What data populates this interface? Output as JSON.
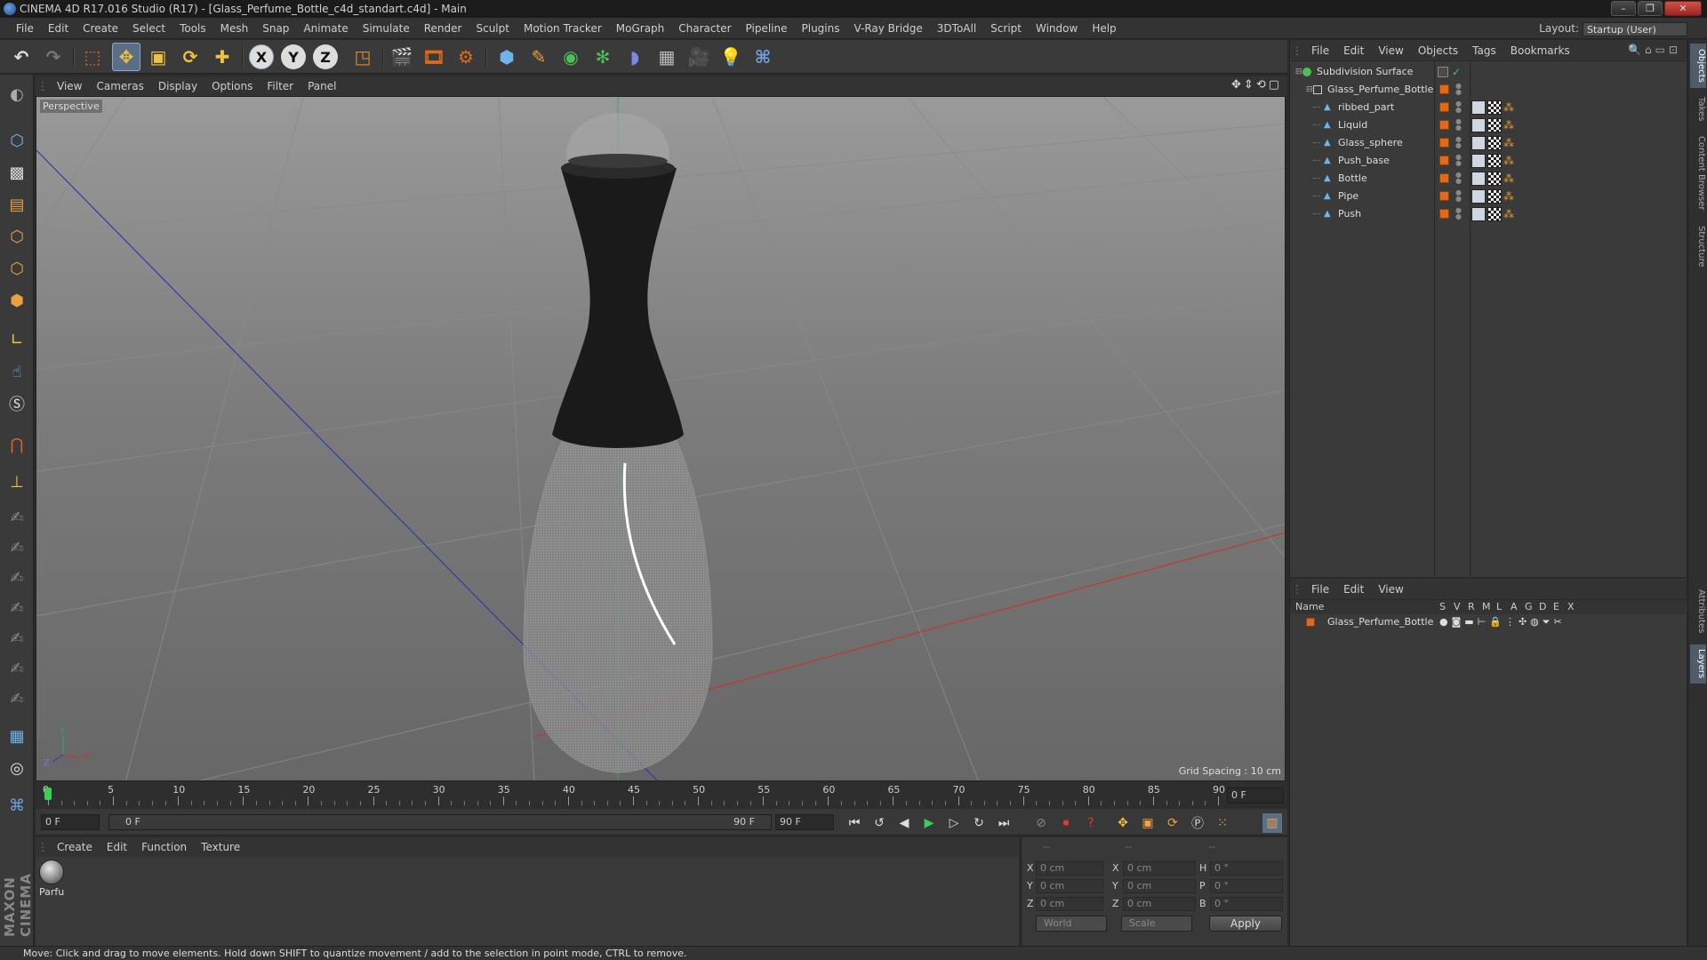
{
  "title": "CINEMA 4D R17.016 Studio (R17) - [Glass_Perfume_Bottle_c4d_standart.c4d] - Main",
  "menu": [
    "File",
    "Edit",
    "Create",
    "Select",
    "Tools",
    "Mesh",
    "Snap",
    "Animate",
    "Simulate",
    "Render",
    "Sculpt",
    "Motion Tracker",
    "MoGraph",
    "Character",
    "Pipeline",
    "Plugins",
    "V-Ray Bridge",
    "3DToAll",
    "Script",
    "Window",
    "Help"
  ],
  "layout": {
    "label": "Layout:",
    "value": "Startup (User)"
  },
  "viewport": {
    "menu": [
      "View",
      "Cameras",
      "Display",
      "Options",
      "Filter",
      "Panel"
    ],
    "label": "Perspective",
    "grid_spacing": "Grid Spacing : 10 cm",
    "axes": {
      "y": "Y",
      "x": "X",
      "z": "Z"
    }
  },
  "timeline": {
    "ticks": [
      "0",
      "5",
      "10",
      "15",
      "20",
      "25",
      "30",
      "35",
      "40",
      "45",
      "50",
      "55",
      "60",
      "65",
      "70",
      "75",
      "80",
      "85",
      "90"
    ],
    "current": "0 F",
    "start": "0 F",
    "range_start": "0 F",
    "range_end": "90 F",
    "end": "90 F"
  },
  "material": {
    "menu": [
      "Create",
      "Edit",
      "Function",
      "Texture"
    ],
    "name": "Parfu"
  },
  "coords": {
    "headers": [
      "--",
      "--",
      "--"
    ],
    "rows": [
      {
        "a": "X",
        "av": "0 cm",
        "b": "X",
        "bv": "0 cm",
        "c": "H",
        "cv": "0 °"
      },
      {
        "a": "Y",
        "av": "0 cm",
        "b": "Y",
        "bv": "0 cm",
        "c": "P",
        "cv": "0 °"
      },
      {
        "a": "Z",
        "av": "0 cm",
        "b": "Z",
        "bv": "0 cm",
        "c": "B",
        "cv": "0 °"
      }
    ],
    "world": "World",
    "scale": "Scale",
    "apply": "Apply"
  },
  "objects": {
    "menu": [
      "File",
      "Edit",
      "View",
      "Objects",
      "Tags",
      "Bookmarks"
    ],
    "items": [
      {
        "name": "Subdivision Surface",
        "level": 0
      },
      {
        "name": "Glass_Perfume_Bottle",
        "level": 1
      },
      {
        "name": "ribbed_part",
        "level": 2
      },
      {
        "name": "Liquid",
        "level": 2
      },
      {
        "name": "Glass_sphere",
        "level": 2
      },
      {
        "name": "Push_base",
        "level": 2
      },
      {
        "name": "Bottle",
        "level": 2
      },
      {
        "name": "Pipe",
        "level": 2
      },
      {
        "name": "Push",
        "level": 2
      }
    ]
  },
  "layers": {
    "menu": [
      "File",
      "Edit",
      "View"
    ],
    "header": {
      "name": "Name",
      "cols": [
        "S",
        "V",
        "R",
        "M",
        "L",
        "A",
        "G",
        "D",
        "E",
        "X"
      ]
    },
    "items": [
      {
        "name": "Glass_Perfume_Bottle",
        "color": "#e06a1a"
      }
    ]
  },
  "side_tabs": [
    "Objects",
    "Takes",
    "Content Browser",
    "Structure",
    "Attributes",
    "Layers"
  ],
  "brand": "MAXON CINEMA 4D",
  "status": "Move: Click and drag to move elements. Hold down SHIFT to quantize movement / add to the selection in point mode, CTRL to remove.",
  "colors": {
    "accent": "#e06a1a",
    "selection": "#5a6e86",
    "x_axis": "#c0392b",
    "z_axis": "#2c3ea8",
    "y_axis": "#3aa655"
  }
}
